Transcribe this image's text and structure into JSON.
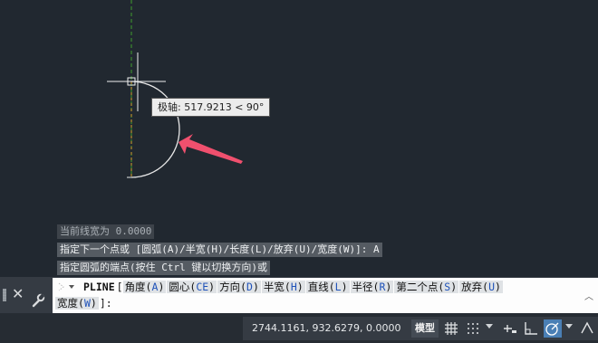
{
  "tooltip": {
    "label": "极轴:",
    "value": "517.9213 < 90°"
  },
  "history": [
    "当前线宽为 0.0000",
    "指定下一个点或 [圆弧(A)/半宽(H)/长度(L)/放弃(U)/宽度(W)]: A",
    "指定圆弧的端点(按住 Ctrl 键以切换方向)或"
  ],
  "command": {
    "name": "PLINE",
    "open_bracket": "[",
    "options": [
      {
        "label": "角度(",
        "key": "A",
        "close": ")"
      },
      {
        "label": "圆心(",
        "key": "CE",
        "close": ")"
      },
      {
        "label": "方向(",
        "key": "D",
        "close": ")"
      },
      {
        "label": "半宽(",
        "key": "H",
        "close": ")"
      },
      {
        "label": "直线(",
        "key": "L",
        "close": ")"
      },
      {
        "label": "半径(",
        "key": "R",
        "close": ")"
      },
      {
        "label": "第二个点(",
        "key": "S",
        "close": ")"
      },
      {
        "label": "放弃(",
        "key": "U",
        "close": ")"
      }
    ],
    "last_option": {
      "label": "宽度(",
      "key": "W",
      "close": ")"
    },
    "tail": "]:"
  },
  "status": {
    "coordinates": "2744.1161, 932.6279, 0.0000",
    "model_tab": "模型"
  },
  "icons": {
    "close": "close-icon",
    "customize": "wrench-icon",
    "grid": "grid-icon",
    "snap": "snap-dots-icon",
    "ortho": "ortho-icon",
    "polar": "polar-tracking-icon"
  },
  "colors": {
    "canvas": "#212830",
    "arrow": "#f0506e",
    "y_axis": "#3f9b2e",
    "active_toggle": "#4a7fb5",
    "option_key": "#1f52b9"
  }
}
